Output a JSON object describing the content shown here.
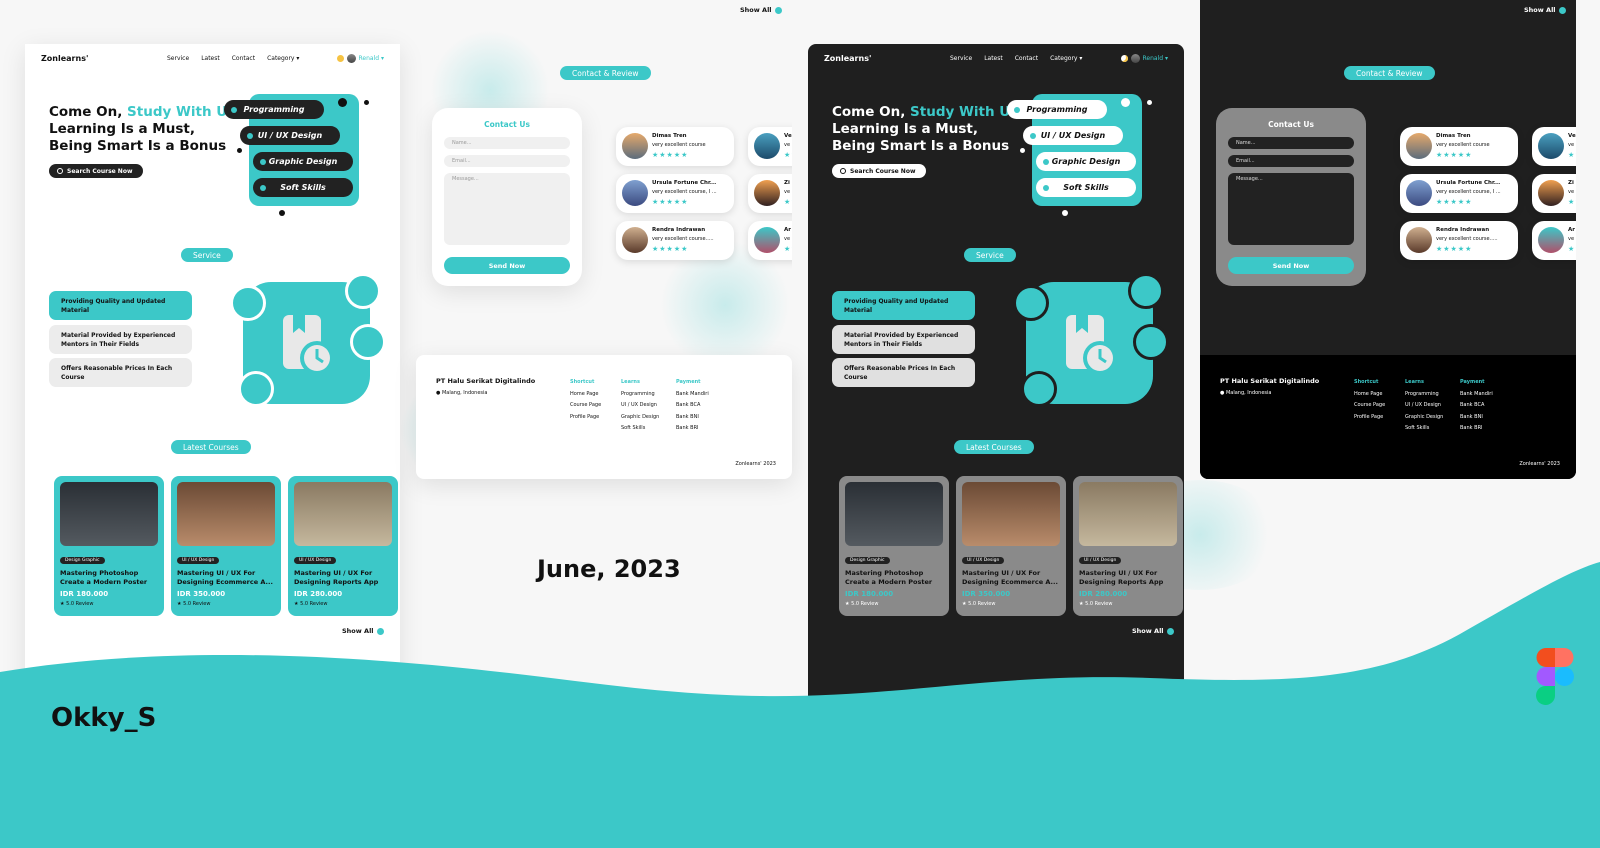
{
  "brand": "Zonlearns'",
  "nav": {
    "service": "Service",
    "latest": "Latest",
    "contact": "Contact",
    "category": "Category ▾",
    "user": "Renald ▾"
  },
  "hero": {
    "title_a": "Come On, ",
    "title_b": "Study With Us",
    "title_c": "Learning Is a Must, Being Smart Is a Bonus",
    "cta": "Search Course Now"
  },
  "categories": [
    "Programming",
    "UI / UX Design",
    "Graphic Design",
    "Soft Skills"
  ],
  "service": {
    "badge": "Service",
    "features": [
      "Providing Quality and Updated Material",
      "Material Provided by Experienced Mentors in Their Fields",
      "Offers Reasonable Prices In Each Course"
    ]
  },
  "latest": {
    "badge": "Latest Courses",
    "show_all": "Show All",
    "courses": [
      {
        "tag": "Design Graphic",
        "title": "Mastering Photoshop Create a Modern Poster",
        "price": "IDR 180.000",
        "review": "★ 5.0 Review"
      },
      {
        "tag": "UI / UX Design",
        "title": "Mastering UI / UX For Designing Ecommerce A...",
        "price": "IDR 350.000",
        "review": "★ 5.0 Review"
      },
      {
        "tag": "UI / UX Design",
        "title": "Mastering UI / UX For Designing Reports App",
        "price": "IDR 280.000",
        "review": "★ 5.0 Review"
      }
    ]
  },
  "contact": {
    "badge": "Contact & Review",
    "title": "Contact Us",
    "name_ph": "Name...",
    "email_ph": "Email...",
    "message_ph": "Message...",
    "send": "Send Now",
    "reviews": [
      {
        "name": "Dimas Tren",
        "comment": "very excellent course",
        "stars": "★★★★★"
      },
      {
        "name": "Ursula Fortune Chr...",
        "comment": "very excellent course, I ...",
        "stars": "★★★★★"
      },
      {
        "name": "Rendra Indrawan",
        "comment": "very excellent course.....",
        "stars": "★★★★★"
      }
    ],
    "reviews_cut": [
      {
        "name": "Ve",
        "comment": "ve",
        "stars": "★★★★★"
      },
      {
        "name": "Zi",
        "comment": "ve",
        "stars": "★★★★★"
      },
      {
        "name": "Ar",
        "comment": "ve",
        "stars": "★★★★★"
      }
    ]
  },
  "footer": {
    "company": "PT Halu Serikat Digitalindo",
    "location": "Malang, Indonesia",
    "shortcut": {
      "head": "Shortcut",
      "items": [
        "Home Page",
        "Course Page",
        "Profile Page"
      ]
    },
    "learns": {
      "head": "Learns",
      "items": [
        "Programming",
        "UI / UX Design",
        "Graphic Design",
        "Soft Skills"
      ]
    },
    "payment": {
      "head": "Payment",
      "items": [
        "Bank Mandiri",
        "Bank BCA",
        "Bank BNI",
        "Bank BRI"
      ]
    },
    "copy": "Zonlearns' 2023"
  },
  "date": "June, 2023",
  "author": "Okky_S",
  "colors": {
    "teal": "#3cc8c8",
    "dark": "#1f1f1f",
    "light": "#ffffff"
  }
}
